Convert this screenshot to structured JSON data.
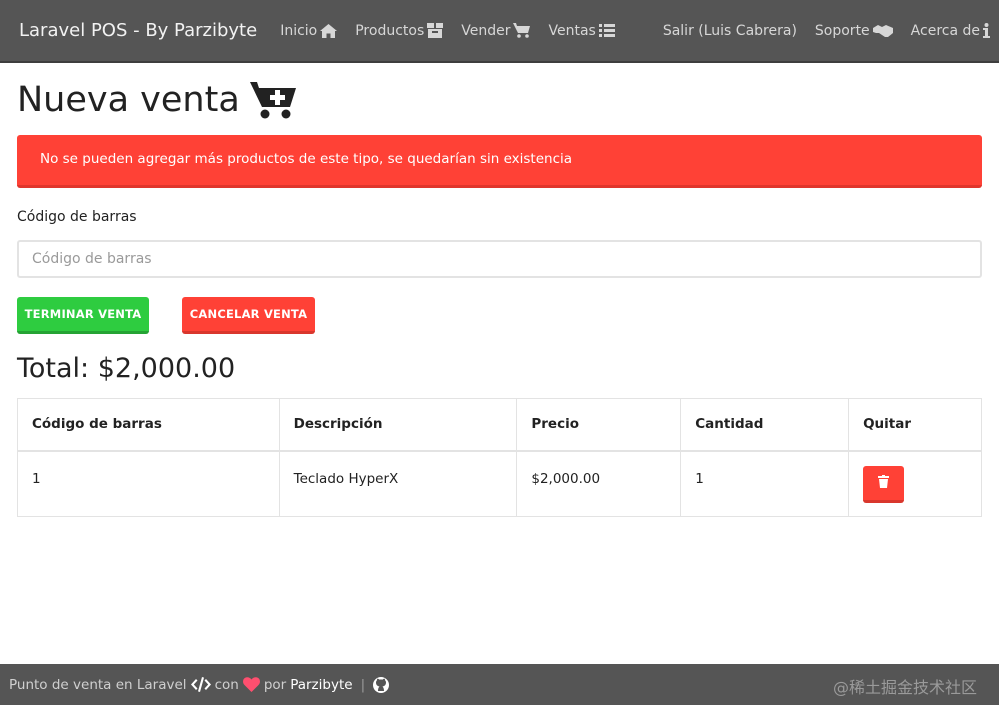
{
  "navbar": {
    "brand": "Laravel POS - By Parzibyte",
    "left_items": [
      {
        "label": "Inicio",
        "icon": "home-icon"
      },
      {
        "label": "Productos",
        "icon": "box-icon"
      },
      {
        "label": "Vender",
        "icon": "cart-plus-icon"
      },
      {
        "label": "Ventas",
        "icon": "list-icon"
      }
    ],
    "right_items": [
      {
        "label": "Salir (Luis Cabrera)",
        "icon": ""
      },
      {
        "label": "Soporte",
        "icon": "handshake-icon"
      },
      {
        "label": "Acerca de",
        "icon": "info-icon"
      }
    ]
  },
  "page": {
    "title": "Nueva venta",
    "title_icon": "cart-plus-icon",
    "alert": "No se pueden agregar más productos de este tipo, se quedarían sin existencia",
    "barcode_label": "Código de barras",
    "barcode_placeholder": "Código de barras",
    "barcode_value": "",
    "finish_button": "TERMINAR VENTA",
    "cancel_button": "CANCELAR VENTA",
    "total": "Total: $2,000.00"
  },
  "table": {
    "headers": [
      "Código de barras",
      "Descripción",
      "Precio",
      "Cantidad",
      "Quitar"
    ],
    "rows": [
      {
        "barcode": "1",
        "description": "Teclado HyperX",
        "price": "$2,000.00",
        "quantity": "1",
        "remove_icon": "trash-icon"
      }
    ]
  },
  "footer": {
    "prefix": "Punto de venta en Laravel",
    "code_icon": "code-icon",
    "con": "con",
    "heart_icon": "heart-icon",
    "por": "por",
    "author": "Parzibyte",
    "separator": "|",
    "github_icon": "github-icon"
  },
  "watermark": "@稀土掘金技术社区",
  "colors": {
    "navbar": "#555555",
    "danger": "#ff4136",
    "success": "#2ecc40"
  }
}
